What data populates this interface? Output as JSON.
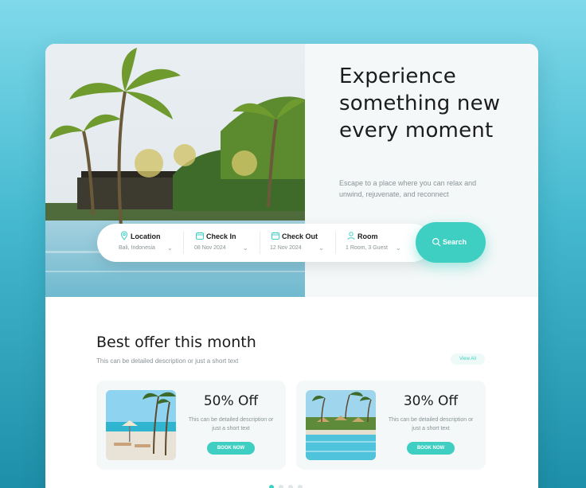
{
  "colors": {
    "accent": "#3fcfc2",
    "text": "#1c1c1c",
    "muted": "#8a9396",
    "panel": "#f4f8f8"
  },
  "hero": {
    "title": "Experience something new every moment",
    "subtitle": "Escape to a place where you can relax and unwind, rejuvenate, and reconnect"
  },
  "search": {
    "fields": [
      {
        "label": "Location",
        "value": "Bali, Indonesia",
        "icon": "map-pin-icon"
      },
      {
        "label": "Check In",
        "value": "08 Nov 2024",
        "icon": "calendar-icon"
      },
      {
        "label": "Check Out",
        "value": "12 Nov 2024",
        "icon": "calendar-icon"
      },
      {
        "label": "Room",
        "value": "1 Room, 3 Guest",
        "icon": "person-icon"
      }
    ],
    "button_label": "Search"
  },
  "offers": {
    "title": "Best offer this month",
    "subtitle": "This can be detailed description or just a short text",
    "view_all": "View All",
    "items": [
      {
        "percent": "50% Off",
        "description": "This can be detailed description or just a short text",
        "button": "BOOK NOW"
      },
      {
        "percent": "30% Off",
        "description": "This can be detailed description or just a short text",
        "button": "BOOK NOW"
      }
    ]
  },
  "pagination": {
    "count": 4,
    "active": 1
  }
}
